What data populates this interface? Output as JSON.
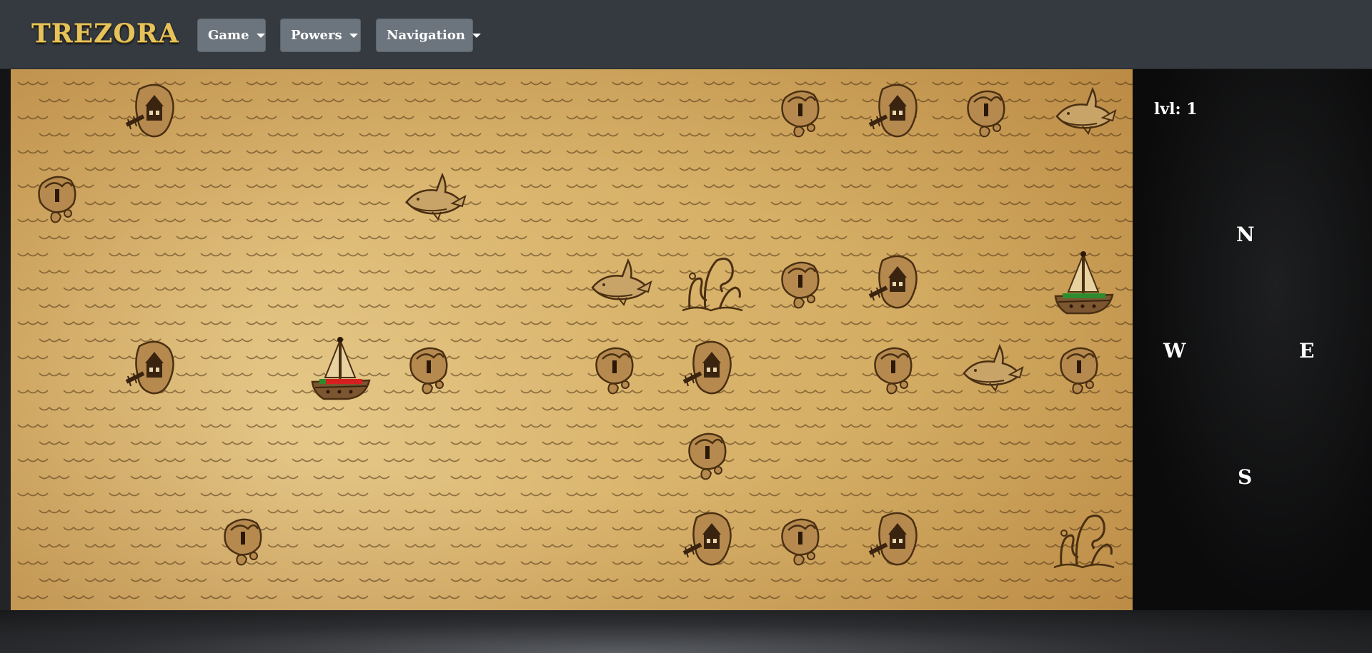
{
  "navbar": {
    "brand": "TREZORA",
    "menus": [
      {
        "label": "Game"
      },
      {
        "label": "Powers"
      },
      {
        "label": "Navigation"
      }
    ]
  },
  "panel": {
    "level": "lvl: 1",
    "compass": {
      "north": "N",
      "west": "W",
      "east": "E",
      "south": "S"
    }
  },
  "colors": {
    "navbar": "#343a40",
    "menu_button": "#6c757d",
    "brand": "#e6c25a",
    "parchment": "#d9b46c",
    "ink": "#4a2f12",
    "player_health": "#2e8b2e",
    "enemy_health": "#d62020"
  },
  "map": {
    "tiles": [
      {
        "kind": "house-island",
        "row": 0,
        "col": 1
      },
      {
        "kind": "tree-island",
        "row": 0,
        "col": 8
      },
      {
        "kind": "house-island",
        "row": 0,
        "col": 9
      },
      {
        "kind": "tree-island",
        "row": 0,
        "col": 10
      },
      {
        "kind": "shark",
        "row": 0,
        "col": 11
      },
      {
        "kind": "tree-island",
        "row": 1,
        "col": 0
      },
      {
        "kind": "shark",
        "row": 1,
        "col": 4
      },
      {
        "kind": "shark",
        "row": 2,
        "col": 6
      },
      {
        "kind": "kraken",
        "row": 2,
        "col": 7
      },
      {
        "kind": "tree-island",
        "row": 2,
        "col": 8
      },
      {
        "kind": "house-island",
        "row": 2,
        "col": 9
      },
      {
        "kind": "ship",
        "row": 2,
        "col": 11,
        "health": 1.0,
        "owner": "enemy"
      },
      {
        "kind": "house-island",
        "row": 3,
        "col": 1
      },
      {
        "kind": "ship",
        "row": 3,
        "col": 3,
        "health": 0.15,
        "owner": "player"
      },
      {
        "kind": "tree-island",
        "row": 3,
        "col": 4
      },
      {
        "kind": "tree-island",
        "row": 3,
        "col": 6
      },
      {
        "kind": "house-island",
        "row": 3,
        "col": 7
      },
      {
        "kind": "tree-island",
        "row": 3,
        "col": 9
      },
      {
        "kind": "shark",
        "row": 3,
        "col": 10
      },
      {
        "kind": "tree-island",
        "row": 3,
        "col": 11
      },
      {
        "kind": "tree-island",
        "row": 4,
        "col": 7
      },
      {
        "kind": "tree-island",
        "row": 5,
        "col": 2
      },
      {
        "kind": "house-island",
        "row": 5,
        "col": 7
      },
      {
        "kind": "tree-island",
        "row": 5,
        "col": 8
      },
      {
        "kind": "house-island",
        "row": 5,
        "col": 9
      },
      {
        "kind": "kraken",
        "row": 5,
        "col": 11
      }
    ]
  }
}
